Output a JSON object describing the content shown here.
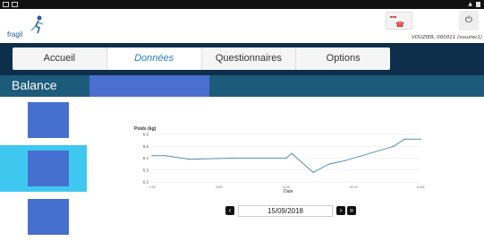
{
  "header": {
    "logo_text": "fragil",
    "user_info": "VOUZIER, 000011 (vouzier1)"
  },
  "nav": {
    "tabs": [
      {
        "label": "Accueil",
        "active": false
      },
      {
        "label": "Données",
        "active": true
      },
      {
        "label": "Questionnaires",
        "active": false
      },
      {
        "label": "Options",
        "active": false
      }
    ]
  },
  "balance": {
    "title": "Balance"
  },
  "side_items": [
    {
      "active": false
    },
    {
      "active": true
    },
    {
      "active": false
    }
  ],
  "chart_data": {
    "type": "line",
    "title": "Poids (kg)",
    "xlabel": "Date",
    "ylabel": "Poids (kg)",
    "ylim": [
      62,
      66
    ],
    "yticks": [
      "6.6",
      "6.5",
      "6.4",
      "6.3",
      "6.2"
    ],
    "xticks": [
      "1.06",
      "6/06",
      "11/06",
      "26.09",
      "10/06"
    ],
    "x": [
      0,
      0.05,
      0.14,
      0.3,
      0.5,
      0.52,
      0.6,
      0.66,
      0.72,
      0.9,
      0.94,
      1.0
    ],
    "values": [
      64.2,
      64.2,
      63.9,
      64.0,
      64.0,
      64.4,
      62.8,
      63.5,
      63.8,
      65.0,
      65.6,
      65.6
    ],
    "color": "#5b8fb0"
  },
  "date_nav": {
    "date": "15/09/2018"
  },
  "colors": {
    "navbar": "#0e2f4b",
    "balance_bar": "#1d5b7a",
    "accent": "#3fc8ef",
    "placeholder_blue": "#4670d0"
  }
}
